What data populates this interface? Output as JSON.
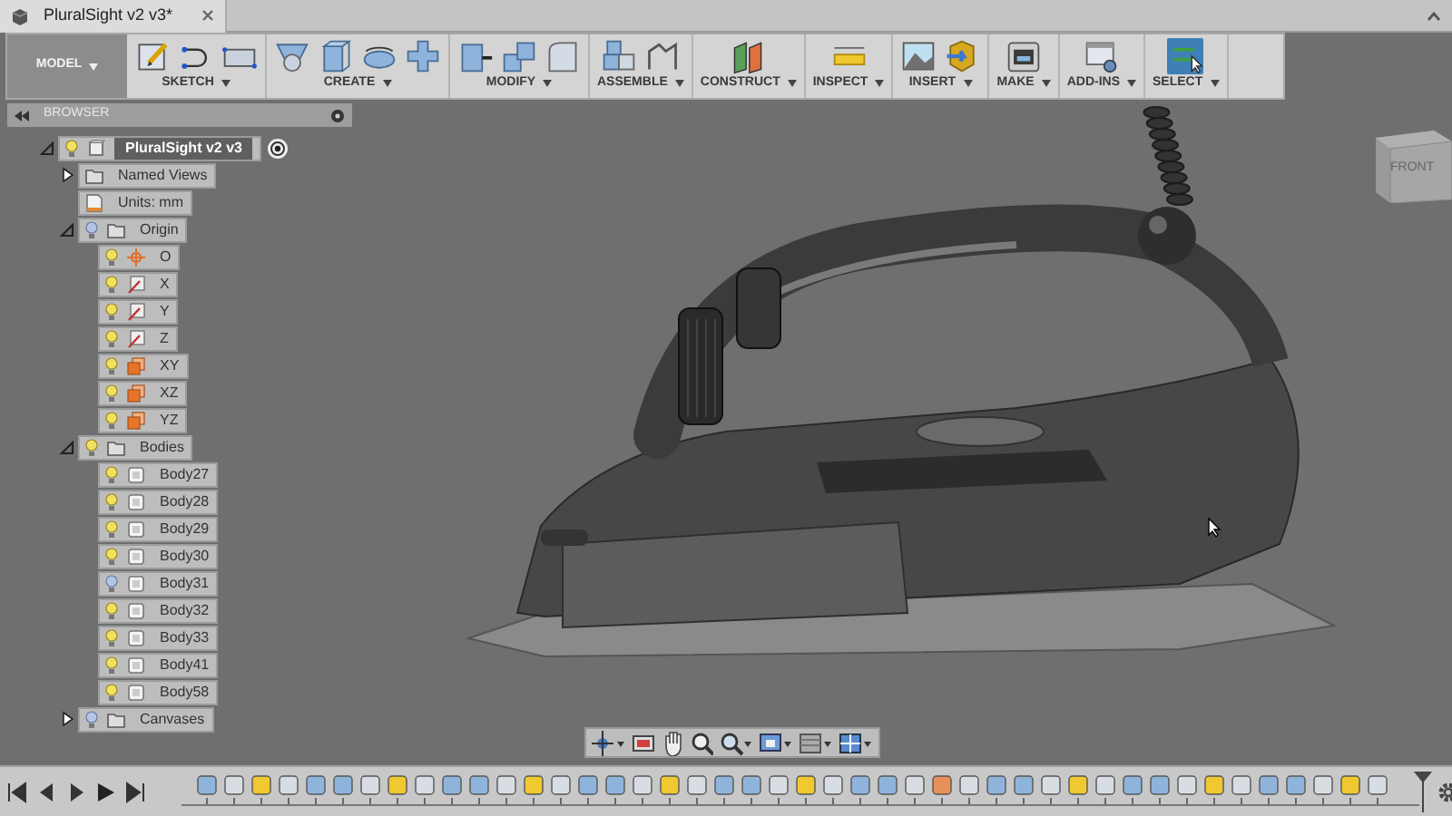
{
  "document_tab": {
    "title": "PluralSight v2 v3*"
  },
  "toolbar": {
    "workspace": "MODEL",
    "groups": [
      {
        "label": "SKETCH",
        "selected": false
      },
      {
        "label": "CREATE",
        "selected": false
      },
      {
        "label": "MODIFY",
        "selected": false
      },
      {
        "label": "ASSEMBLE",
        "selected": false
      },
      {
        "label": "CONSTRUCT",
        "selected": false
      },
      {
        "label": "INSPECT",
        "selected": false
      },
      {
        "label": "INSERT",
        "selected": false
      },
      {
        "label": "MAKE",
        "selected": false
      },
      {
        "label": "ADD-INS",
        "selected": false
      },
      {
        "label": "SELECT",
        "selected": true
      }
    ]
  },
  "browser": {
    "title": "BROWSER",
    "tree": [
      {
        "label": "PluralSight v2 v3",
        "kind": "component",
        "visible": true,
        "expanded": true,
        "children": [
          {
            "label": "Named Views",
            "kind": "folder",
            "expanded": false
          },
          {
            "label": "Units: mm",
            "kind": "units"
          },
          {
            "label": "Origin",
            "kind": "folder",
            "visible": false,
            "expanded": true,
            "children": [
              {
                "label": "O",
                "kind": "point",
                "visible": true
              },
              {
                "label": "X",
                "kind": "axis",
                "visible": true
              },
              {
                "label": "Y",
                "kind": "axis",
                "visible": true
              },
              {
                "label": "Z",
                "kind": "axis",
                "visible": true
              },
              {
                "label": "XY",
                "kind": "plane",
                "visible": true
              },
              {
                "label": "XZ",
                "kind": "plane",
                "visible": true
              },
              {
                "label": "YZ",
                "kind": "plane",
                "visible": true
              }
            ]
          },
          {
            "label": "Bodies",
            "kind": "folder",
            "visible": true,
            "expanded": true,
            "children": [
              {
                "label": "Body27",
                "kind": "body",
                "visible": true
              },
              {
                "label": "Body28",
                "kind": "body",
                "visible": true
              },
              {
                "label": "Body29",
                "kind": "body",
                "visible": true
              },
              {
                "label": "Body30",
                "kind": "body",
                "visible": true
              },
              {
                "label": "Body31",
                "kind": "body",
                "visible": false
              },
              {
                "label": "Body32",
                "kind": "body",
                "visible": true
              },
              {
                "label": "Body33",
                "kind": "body",
                "visible": true
              },
              {
                "label": "Body41",
                "kind": "body",
                "visible": true
              },
              {
                "label": "Body58",
                "kind": "body",
                "visible": true
              }
            ]
          },
          {
            "label": "Canvases",
            "kind": "folder",
            "visible": false,
            "expanded": false
          }
        ]
      }
    ]
  },
  "viewcube": {
    "face": "FRONT"
  }
}
